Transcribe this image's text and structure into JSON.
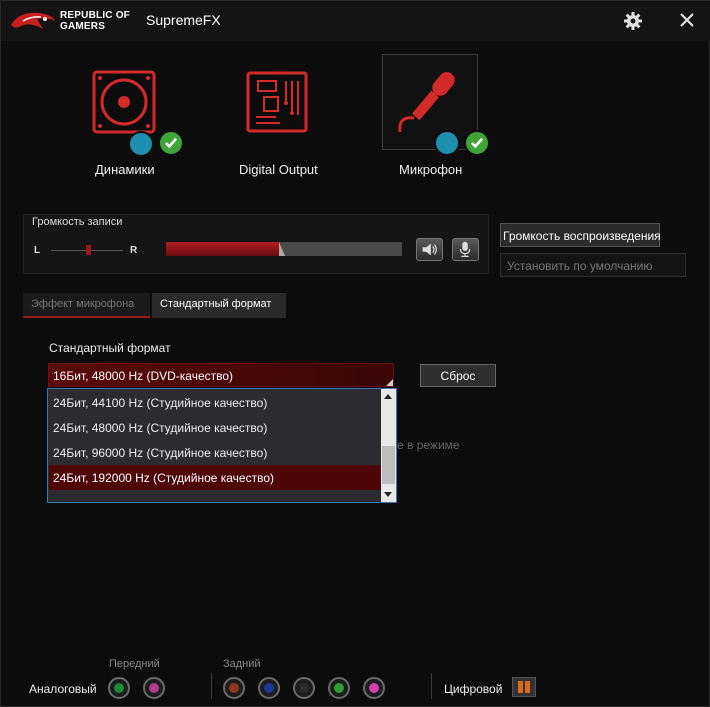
{
  "app": {
    "brand_line1": "REPUBLIC OF",
    "brand_line2": "GAMERS",
    "title": "SupremeFX",
    "settings_icon": "gear-icon",
    "close_icon": "close-icon"
  },
  "devices": [
    {
      "label": "Динамики",
      "icon": "speaker-icon",
      "active": false
    },
    {
      "label": "Digital Output",
      "icon": "circuit-board-icon",
      "active": false
    },
    {
      "label": "Микрофон",
      "icon": "microphone-icon",
      "active": true
    }
  ],
  "recording": {
    "title": "Громкость записи",
    "left": "L",
    "right": "R",
    "volume_percent": 48,
    "buttons": [
      "speaker-icon",
      "microphone-icon"
    ]
  },
  "side_buttons": {
    "playback": "Громкость воспроизведения",
    "default": "Установить по умолчанию"
  },
  "tabs": [
    {
      "label": "Эффект микрофона",
      "active": false
    },
    {
      "label": "Стандартный формат",
      "active": true
    }
  ],
  "format": {
    "section_label": "Стандартный формат",
    "selected": "16Бит, 48000 Hz (DVD-качество)",
    "reset_label": "Сброс",
    "options": [
      "24Бит, 44100 Hz (Студийное качество)",
      "24Бит, 48000 Hz (Студийное качество)",
      "24Бит, 96000 Hz (Студийное качество)",
      "24Бит, 192000 Hz (Студийное качество)"
    ],
    "highlighted_index": 3,
    "obscured_text": "е в режиме"
  },
  "bottom": {
    "analog_label": "Аналоговый",
    "front_label": "Передний",
    "rear_label": "Задний",
    "digital_label": "Цифровой",
    "front_jacks": [
      "#1e8a2e",
      "#b03a8a"
    ],
    "rear_jacks": [
      "#8a3a1a",
      "#1a3a9a",
      "#2a2a2a",
      "#2aa02a",
      "#d040b0"
    ]
  }
}
